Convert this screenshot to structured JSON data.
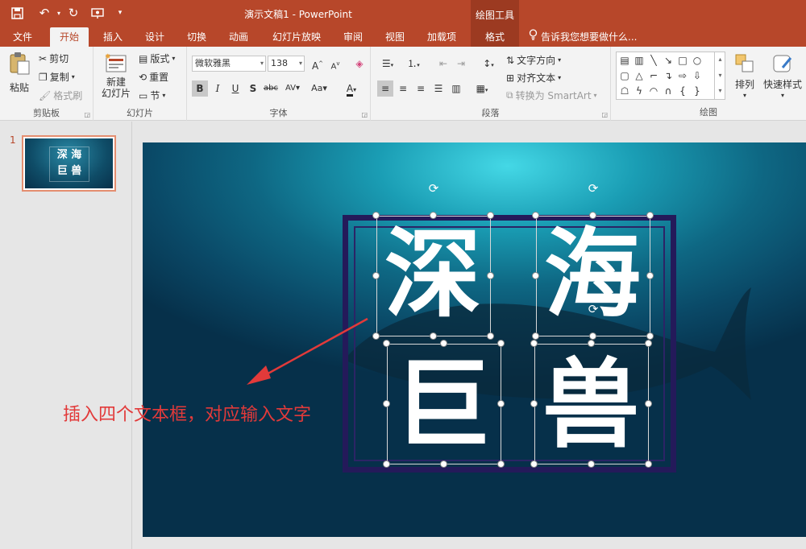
{
  "titlebar": {
    "title": "演示文稿1 - PowerPoint",
    "context_tools_label": "绘图工具"
  },
  "tabs": [
    {
      "label": "文件"
    },
    {
      "label": "开始",
      "active": true
    },
    {
      "label": "插入"
    },
    {
      "label": "设计"
    },
    {
      "label": "切换"
    },
    {
      "label": "动画"
    },
    {
      "label": "幻灯片放映"
    },
    {
      "label": "审阅"
    },
    {
      "label": "视图"
    },
    {
      "label": "加载项"
    },
    {
      "label": "格式",
      "context": true
    }
  ],
  "tellme": {
    "text": "告诉我您想要做什么..."
  },
  "ribbon": {
    "clipboard": {
      "label": "剪贴板",
      "paste": "粘贴",
      "cut": "剪切",
      "copy": "复制",
      "format_painter": "格式刷"
    },
    "slides": {
      "label": "幻灯片",
      "new_slide_line1": "新建",
      "new_slide_line2": "幻灯片",
      "layout": "版式",
      "reset": "重置",
      "section": "节"
    },
    "font": {
      "label": "字体",
      "font_name": "微软雅黑",
      "font_size": "138"
    },
    "paragraph": {
      "label": "段落",
      "text_direction": "文字方向",
      "align_text": "对齐文本",
      "convert_smartart": "转换为 SmartArt"
    },
    "drawing": {
      "label": "绘图",
      "arrange": "排列",
      "quick_styles": "快速样式"
    }
  },
  "thumbnails": [
    {
      "number": "1",
      "line1": "深 海",
      "line2": "巨 兽"
    }
  ],
  "slide": {
    "chars": [
      "深",
      "海",
      "巨",
      "兽"
    ],
    "annotation": "插入四个文本框，对应输入文字"
  },
  "colors": {
    "brand": "#b7472a",
    "context_tab": "#9c3a21",
    "annotation": "#e23a3a",
    "frame": "#241a5a"
  }
}
